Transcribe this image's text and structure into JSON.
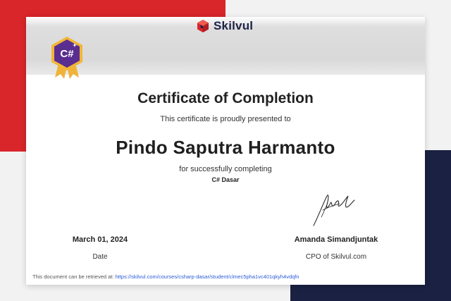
{
  "brand": {
    "name": "Skilvul",
    "primary_color": "#d8262b",
    "navy_color": "#1a2142"
  },
  "badge": {
    "label": "C#",
    "icon": "csharp-badge-icon"
  },
  "certificate": {
    "title": "Certificate of Completion",
    "subtitle": "This certificate is proudly presented to",
    "recipient": "Pindo Saputra Harmanto",
    "completing_text": "for successfully completing",
    "course": "C# Dasar"
  },
  "date": {
    "value": "March 01, 2024",
    "label": "Date"
  },
  "signer": {
    "name": "Amanda Simandjuntak",
    "title": "CPO of Skilvul.com"
  },
  "footer": {
    "text": "This document can be retrieved at:",
    "link": "https://skilvul.com/courses/csharp-dasar/student/clmec5pha1vc401qkyh4vdqfn"
  }
}
